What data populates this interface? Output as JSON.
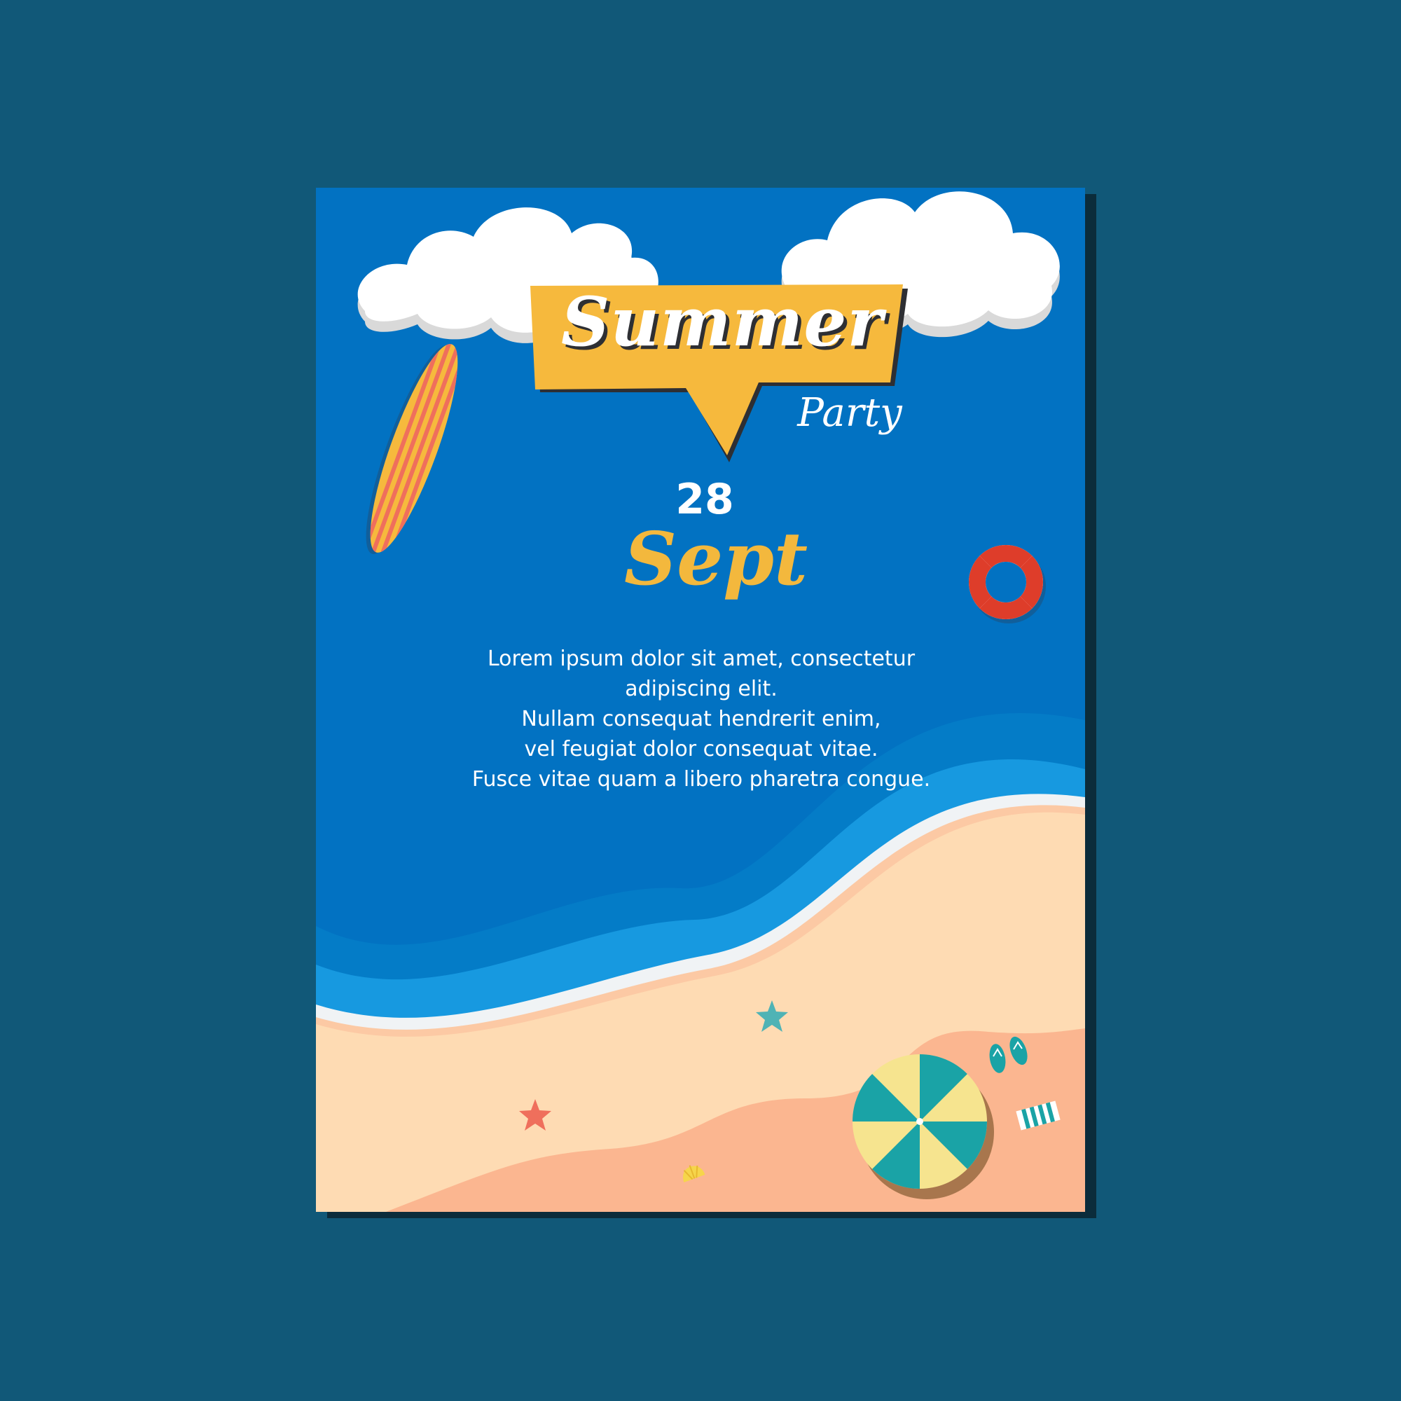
{
  "flyer": {
    "title": "Summer",
    "subtitle": "Party",
    "date_day": "28",
    "date_month": "Sept",
    "body_lines": [
      "Lorem ipsum dolor sit amet, consectetur",
      "adipiscing elit.",
      "Nullam consequat hendrerit enim,",
      "vel feugiat dolor consequat vitae.",
      "Fusce vitae quam a libero pharetra congue."
    ]
  },
  "colors": {
    "page_background": "#115878",
    "sky": "#0272c2",
    "banner_yellow": "#f6b93d",
    "month_yellow": "#f3b83d",
    "sand": "#fedbb3",
    "sand_dark": "#fbb690",
    "wave_light": "#1799e0",
    "lifebuoy_red": "#de3d2a"
  },
  "icons": [
    "cloud-icon",
    "surfboard-icon",
    "lifebuoy-icon",
    "starfish-icon",
    "seashell-icon",
    "beach-umbrella-icon",
    "flip-flops-icon",
    "towel-icon"
  ]
}
